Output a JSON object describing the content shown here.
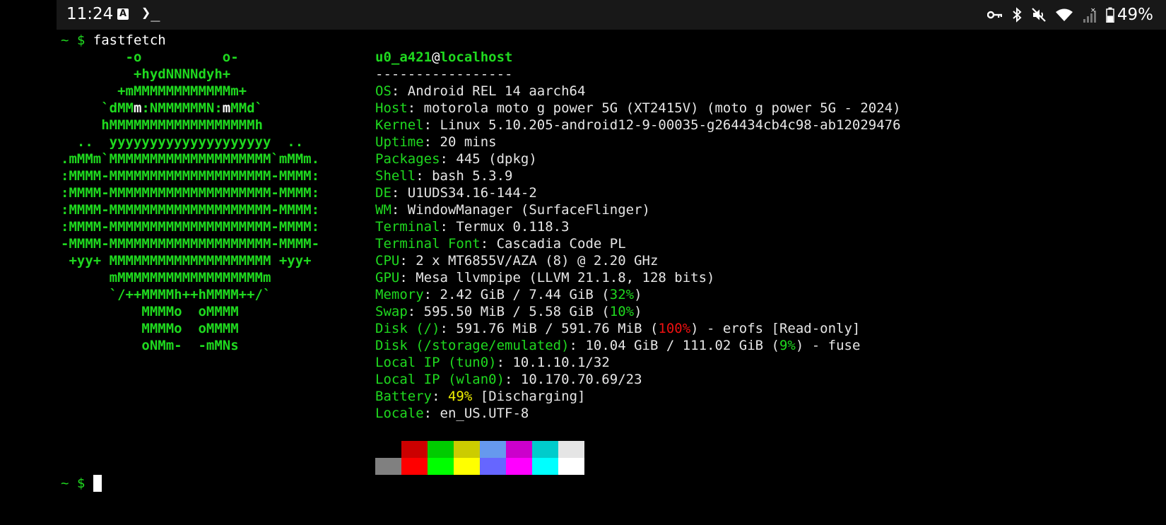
{
  "status_bar": {
    "time": "11:24",
    "keyboard_icon_letter": "A",
    "termux_icon": "❯_",
    "battery_percent": "49%",
    "battery_level": 0.49,
    "icons": [
      "vpn-key-icon",
      "bluetooth-icon",
      "mute-icon",
      "wifi-icon",
      "cell-signal-icon",
      "battery-icon"
    ]
  },
  "terminal": {
    "prompt_symbol": "~ $",
    "command": "fastfetch",
    "logo_lines": [
      "        -o          o-",
      "         +hydNNNNdyh+",
      "       +mMMMMMMMMMMMMm+",
      "     `dMM",
      "     hMMMMMMMMMMMMMMMMMMh",
      "  ..  yyyyyyyyyyyyyyyyyyyy  ..",
      ".mMMm`MMMMMMMMMMMMMMMMMMMM`mMMm.",
      ":MMMM-MMMMMMMMMMMMMMMMMMMM-MMMM:",
      ":MMMM-MMMMMMMMMMMMMMMMMMMM-MMMM:",
      ":MMMM-MMMMMMMMMMMMMMMMMMMM-MMMM:",
      ":MMMM-MMMMMMMMMMMMMMMMMMMM-MMMM:",
      "-MMMM-MMMMMMMMMMMMMMMMMMMM-MMMM-",
      " +yy+ MMMMMMMMMMMMMMMMMMMM +yy+",
      "      mMMMMMMMMMMMMMMMMMMm",
      "      `/++MMMMh++hMMMM++/`",
      "          MMMMo  oMMMM",
      "          MMMMo  oMMMM",
      "          oNMm-  -mMNs"
    ],
    "logo_line4_parts": {
      "a": "     `dMM",
      "b": "m",
      "c": ":NMMMMMMN:",
      "d": "m",
      "e": "MMd`"
    },
    "user": "u0_a421",
    "at": "@",
    "host": "localhost",
    "separator": "-----------------",
    "info": [
      {
        "key": "OS",
        "value": "Android REL 14 aarch64"
      },
      {
        "key": "Host",
        "value": "motorola moto g power 5G (XT2415V) (moto g power 5G - 2024)"
      },
      {
        "key": "Kernel",
        "value": "Linux 5.10.205-android12-9-00035-g264434cb4c98-ab12029476"
      },
      {
        "key": "Uptime",
        "value": "20 mins"
      },
      {
        "key": "Packages",
        "value": "445 (dpkg)"
      },
      {
        "key": "Shell",
        "value": "bash 5.3.9"
      },
      {
        "key": "DE",
        "value": "U1UDS34.16-144-2"
      },
      {
        "key": "WM",
        "value": "WindowManager (SurfaceFlinger)"
      },
      {
        "key": "Terminal",
        "value": "Termux 0.118.3"
      },
      {
        "key": "Terminal Font",
        "value": "Cascadia Code PL"
      },
      {
        "key": "CPU",
        "value": "2 x MT6855V/AZA (8) @ 2.20 GHz"
      },
      {
        "key": "GPU",
        "value": "Mesa llvmpipe (LLVM 21.1.8, 128 bits)"
      }
    ],
    "memory": {
      "key": "Memory",
      "value": "2.42 GiB / 7.44 GiB (",
      "pct": "32%",
      "tail": ")"
    },
    "swap": {
      "key": "Swap",
      "value": "595.50 MiB / 5.58 GiB (",
      "pct": "10%",
      "tail": ")"
    },
    "disk_root": {
      "key": "Disk (/)",
      "value": "591.76 MiB / 591.76 MiB (",
      "pct": "100%",
      "tail": ") - erofs [Read-only]"
    },
    "disk_storage": {
      "key": "Disk (/storage/emulated)",
      "value": "10.04 GiB / 111.02 GiB (",
      "pct": "9%",
      "tail": ") - fuse"
    },
    "local_ip_tun0": {
      "key": "Local IP (tun0)",
      "value": "10.1.10.1/32"
    },
    "local_ip_wlan0": {
      "key": "Local IP (wlan0)",
      "value": "10.170.70.69/23"
    },
    "battery": {
      "key": "Battery",
      "pct": "49%",
      "tail": "[Discharging]"
    },
    "locale": {
      "key": "Locale",
      "value": "en_US.UTF-8"
    },
    "palette_top": [
      "#000000",
      "#cc0000",
      "#00cc00",
      "#cccc00",
      "#6699ee",
      "#cc00cc",
      "#00cccc",
      "#e5e5e5"
    ],
    "palette_bottom": [
      "#808080",
      "#ff0000",
      "#00ff00",
      "#ffff00",
      "#6666ff",
      "#ff00ff",
      "#00ffff",
      "#ffffff"
    ],
    "prompt2_symbol": "~ $"
  },
  "colors": {
    "accent_green": "#1fd91f",
    "text": "#e6e6e6",
    "warn_yellow": "#f0f000",
    "danger_red": "#ee1111",
    "statusbar_bg": "#181818"
  }
}
